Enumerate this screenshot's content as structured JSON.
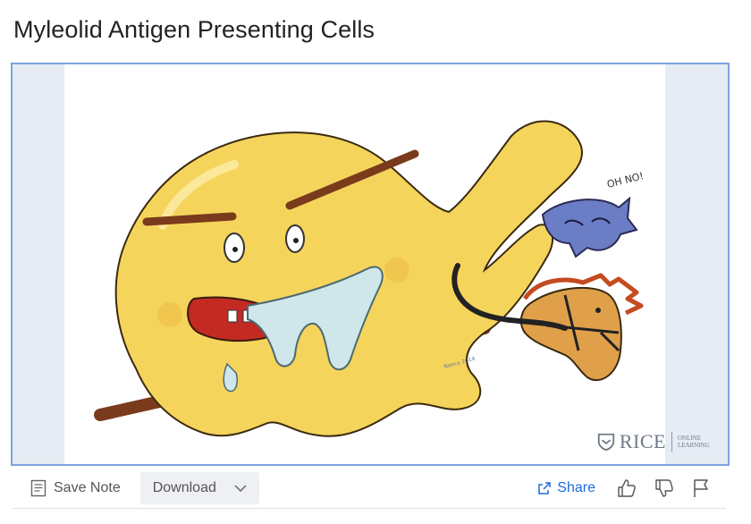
{
  "page": {
    "title": "Myleolid Antigen Presenting Cells"
  },
  "video": {
    "bubble_text": "OH NO!",
    "signature": "Nancy 2014",
    "watermark": {
      "name": "RICE",
      "subtitle": "ONLINE LEARNING"
    }
  },
  "toolbar": {
    "save_note_label": "Save Note",
    "download_label": "Download",
    "share_label": "Share"
  },
  "icons": {
    "save_note": "note-icon",
    "download_caret": "chevron-down-icon",
    "share": "share-icon",
    "like": "thumbs-up-icon",
    "dislike": "thumbs-down-icon",
    "flag": "flag-icon"
  },
  "colors": {
    "accent": "#1e6bd6",
    "frame_border": "#7da2dc",
    "cell_yellow": "#f5d45c"
  }
}
